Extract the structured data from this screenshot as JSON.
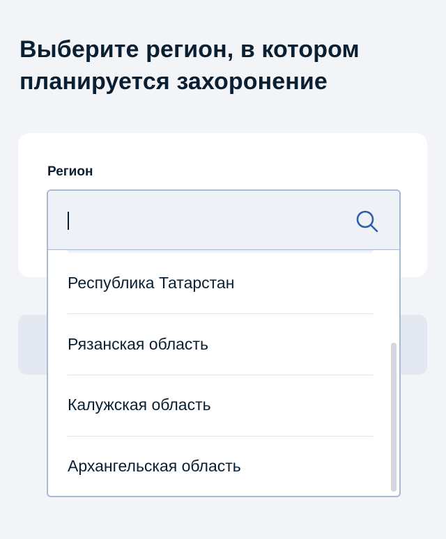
{
  "page": {
    "title": "Выберите регион, в котором планируется захоронение"
  },
  "region_field": {
    "label": "Регион",
    "value": "",
    "placeholder": "",
    "search_icon": "search-icon"
  },
  "dropdown": {
    "options": [
      {
        "label": "Республика Татарстан"
      },
      {
        "label": "Рязанская область"
      },
      {
        "label": "Калужская область"
      },
      {
        "label": "Архангельская область"
      }
    ]
  },
  "colors": {
    "background": "#f2f4f8",
    "text": "#0b1f33",
    "field_border": "#a9b9d4",
    "search_icon": "#2d5fa8",
    "muted_button": "#e3e8f1"
  }
}
